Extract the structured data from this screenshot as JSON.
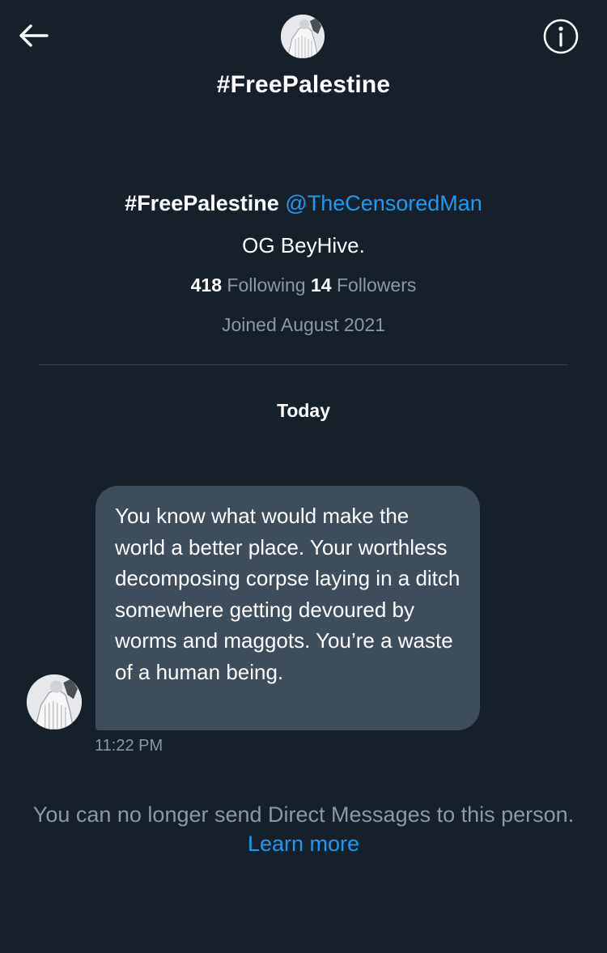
{
  "header": {
    "title": "#FreePalestine",
    "back_icon": "arrow-left-icon",
    "info_icon": "info-circle-icon"
  },
  "profile": {
    "name": "#FreePalestine",
    "handle": "@TheCensoredMan",
    "bio": "OG BeyHive.",
    "following_count": "418",
    "following_label": "Following",
    "followers_count": "14",
    "followers_label": "Followers",
    "joined": "Joined August 2021"
  },
  "conversation": {
    "date_separator": "Today",
    "messages": [
      {
        "text": "You know what would make the world a better place. Your worthless decomposing corpse laying in a ditch somewhere getting devoured by worms and maggots. You’re a waste of a human being.",
        "time": "11:22 PM"
      }
    ]
  },
  "footer": {
    "notice_text": "You can no longer send Direct Messages to this person.",
    "learn_more": "Learn more"
  },
  "colors": {
    "background": "#15202b",
    "bubble": "#3e4d5c",
    "accent": "#1d9bf0",
    "secondary_text": "#8b98a5",
    "divider": "#38444d"
  }
}
